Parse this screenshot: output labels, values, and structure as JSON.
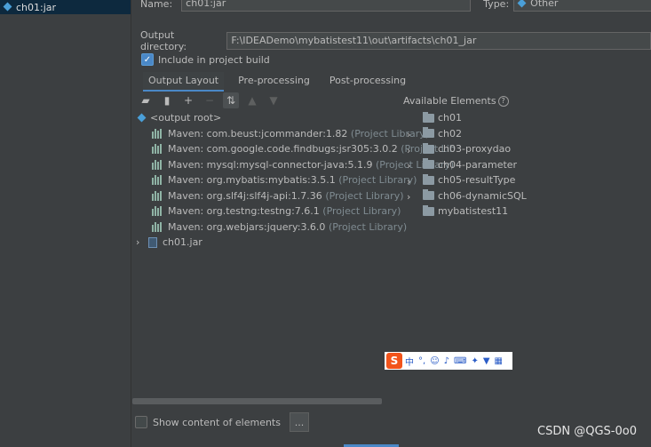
{
  "left_pane": {
    "selected_artifact": "ch01:jar"
  },
  "form": {
    "name_label": "Name:",
    "name_value": "ch01:jar",
    "type_label": "Type:",
    "type_value": "Other",
    "output_dir_label": "Output directory:",
    "output_dir_value": "F:\\IDEADemo\\mybatistest11\\out\\artifacts\\ch01_jar",
    "include_label": "Include in project build"
  },
  "tabs": [
    "Output Layout",
    "Pre-processing",
    "Post-processing"
  ],
  "toolbar_icons": [
    "new-folder-icon",
    "archive-icon",
    "add-icon",
    "remove-icon",
    "sort-icon",
    "move-up-icon",
    "move-down-icon"
  ],
  "available_elements_label": "Available Elements",
  "tree": {
    "root": "<output root>",
    "items": [
      {
        "name": "Maven: com.beust:jcommander:1.82",
        "suffix": "(Project Library)"
      },
      {
        "name": "Maven: com.google.code.findbugs:jsr305:3.0.2",
        "suffix": "(Project Lib"
      },
      {
        "name": "Maven: mysql:mysql-connector-java:5.1.9",
        "suffix": "(Project Library)"
      },
      {
        "name": "Maven: org.mybatis:mybatis:3.5.1",
        "suffix": "(Project Library)"
      },
      {
        "name": "Maven: org.slf4j:slf4j-api:1.7.36",
        "suffix": "(Project Library)"
      },
      {
        "name": "Maven: org.testng:testng:7.6.1",
        "suffix": "(Project Library)"
      },
      {
        "name": "Maven: org.webjars:jquery:3.6.0",
        "suffix": "(Project Library)"
      }
    ],
    "jar": "ch01.jar"
  },
  "elements": [
    "ch01",
    "ch02",
    "ch03-proxydao",
    "ch04-parameter",
    "ch05-resultType",
    "ch06-dynamicSQL",
    "mybatistest11"
  ],
  "show_content_label": "Show content of elements",
  "ellipsis": "...",
  "ime": {
    "logo": "S",
    "lang": "中"
  },
  "watermark": "CSDN @QGS-0o0"
}
